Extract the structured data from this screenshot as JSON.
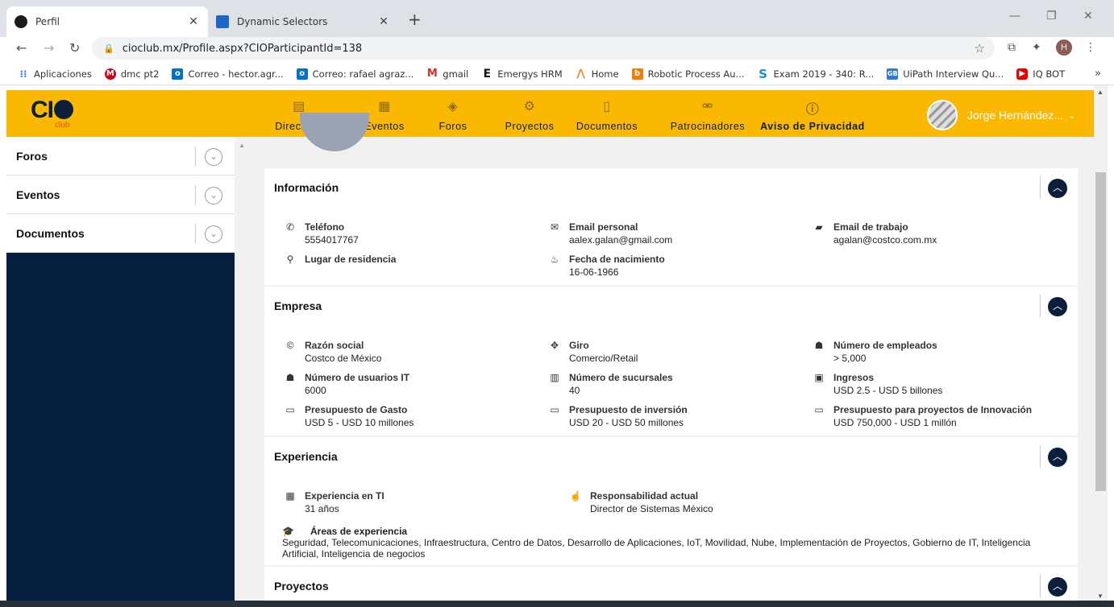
{
  "browser": {
    "tabs": [
      {
        "title": "Perfil",
        "active": true
      },
      {
        "title": "Dynamic Selectors",
        "active": false
      }
    ],
    "url": "cioclub.mx/Profile.aspx?CIOParticipantId=138",
    "profile_initial": "H",
    "bookmarks": [
      {
        "label": "Aplicaciones",
        "icon": "apps-grid-icon"
      },
      {
        "label": "dmc pt2",
        "icon": "dmc-icon"
      },
      {
        "label": "Correo - hector.agr...",
        "icon": "outlook-icon"
      },
      {
        "label": "Correo: rafael agraz...",
        "icon": "outlook-icon"
      },
      {
        "label": "gmail",
        "icon": "gmail-icon"
      },
      {
        "label": "Emergys HRM",
        "icon": "emergys-icon"
      },
      {
        "label": "Home",
        "icon": "home-icon"
      },
      {
        "label": "Robotic Process Au...",
        "icon": "rpa-icon"
      },
      {
        "label": "Exam 2019 - 340: R...",
        "icon": "skype-icon"
      },
      {
        "label": "UiPath Interview Qu...",
        "icon": "gb-icon"
      },
      {
        "label": "IQ BOT",
        "icon": "youtube-icon"
      }
    ]
  },
  "site": {
    "logo_text": "CI",
    "logo_sub": "club",
    "nav": [
      {
        "label": "Directorio",
        "icon": "directory-icon"
      },
      {
        "label": "Eventos",
        "icon": "calendar-icon"
      },
      {
        "label": "Foros",
        "icon": "forum-icon"
      },
      {
        "label": "Proyectos",
        "icon": "gears-icon"
      },
      {
        "label": "Documentos",
        "icon": "document-icon"
      },
      {
        "label": "Patrocinadores",
        "icon": "handshake-icon"
      },
      {
        "label": "Aviso de Privacidad",
        "icon": "privacy-icon"
      }
    ],
    "user_name": "Jorge Hernández..."
  },
  "sidebar": {
    "items": [
      {
        "label": "Foros"
      },
      {
        "label": "Eventos"
      },
      {
        "label": "Documentos"
      }
    ]
  },
  "info": {
    "title": "Información",
    "phone_label": "Teléfono",
    "phone": "5554017767",
    "email_personal_label": "Email personal",
    "email_personal": "aalex.galan@gmail.com",
    "email_work_label": "Email de trabajo",
    "email_work": "agalan@costco.com.mx",
    "residence_label": "Lugar de residencia",
    "birth_label": "Fecha de nacimiento",
    "birth": "16-06-1966"
  },
  "empresa": {
    "title": "Empresa",
    "razon_label": "Razón social",
    "razon": "Costco de México",
    "giro_label": "Giro",
    "giro": "Comercio/Retail",
    "empleados_label": "Número de empleados",
    "empleados": "> 5,000",
    "usuarios_label": "Número de usuarios IT",
    "usuarios": "6000",
    "sucursales_label": "Número de sucursales",
    "sucursales": "40",
    "ingresos_label": "Ingresos",
    "ingresos": "USD 2.5 - USD 5 billones",
    "gasto_label": "Presupuesto de Gasto",
    "gasto": "USD 5 - USD 10 millones",
    "inversion_label": "Presupuesto de inversión",
    "inversion": "USD 20 - USD 50 millones",
    "innovacion_label": "Presupuesto para proyectos de Innovación",
    "innovacion": "USD 750,000 - USD 1 millón"
  },
  "experiencia": {
    "title": "Experiencia",
    "ti_label": "Experiencia en TI",
    "ti": "31 años",
    "resp_label": "Responsabilidad actual",
    "resp": "Director de Sistemas México",
    "areas_label": "Áreas de experiencia",
    "areas": "Seguridad, Telecomunicaciones, Infraestructura, Centro de Datos, Desarrollo de Aplicaciones, IoT, Movilidad, Nube, Implementación de Proyectos, Gobierno de IT, Inteligencia Artificial, Inteligencia de negocios"
  },
  "proyectos": {
    "title": "Proyectos"
  },
  "colors": {
    "brand_yellow": "#fbb800",
    "navy": "#0b1f3a"
  }
}
